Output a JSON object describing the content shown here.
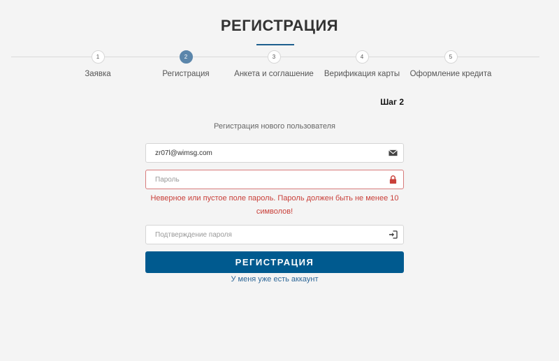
{
  "page_title": "РЕГИСТРАЦИЯ",
  "steps": [
    {
      "number": "1",
      "label": "Заявка",
      "active": false
    },
    {
      "number": "2",
      "label": "Регистрация",
      "active": true
    },
    {
      "number": "3",
      "label": "Анкета и соглашение",
      "active": false
    },
    {
      "number": "4",
      "label": "Верификация карты",
      "active": false
    },
    {
      "number": "5",
      "label": "Оформление кредита",
      "active": false
    }
  ],
  "step_indicator": "Шаг 2",
  "form": {
    "subtitle": "Регистрация нового пользователя",
    "email": {
      "value": "zr07l@wimsg.com",
      "placeholder": "",
      "icon": "envelope-icon"
    },
    "password": {
      "value": "",
      "placeholder": "Пароль",
      "icon": "lock-icon",
      "state": "error"
    },
    "error_message": "Неверное или пустое поле пароль. Пароль должен быть не менее 10 символов!",
    "confirm_password": {
      "value": "",
      "placeholder": "Подтверждение пароля",
      "icon": "sign-in-icon"
    },
    "submit_label": "РЕГИСТРАЦИЯ",
    "login_link": "У меня уже есть аккаунт"
  },
  "colors": {
    "accent": "#005a8f",
    "active_step": "#5b86ab",
    "error": "#c9403a",
    "link": "#2c6697"
  }
}
